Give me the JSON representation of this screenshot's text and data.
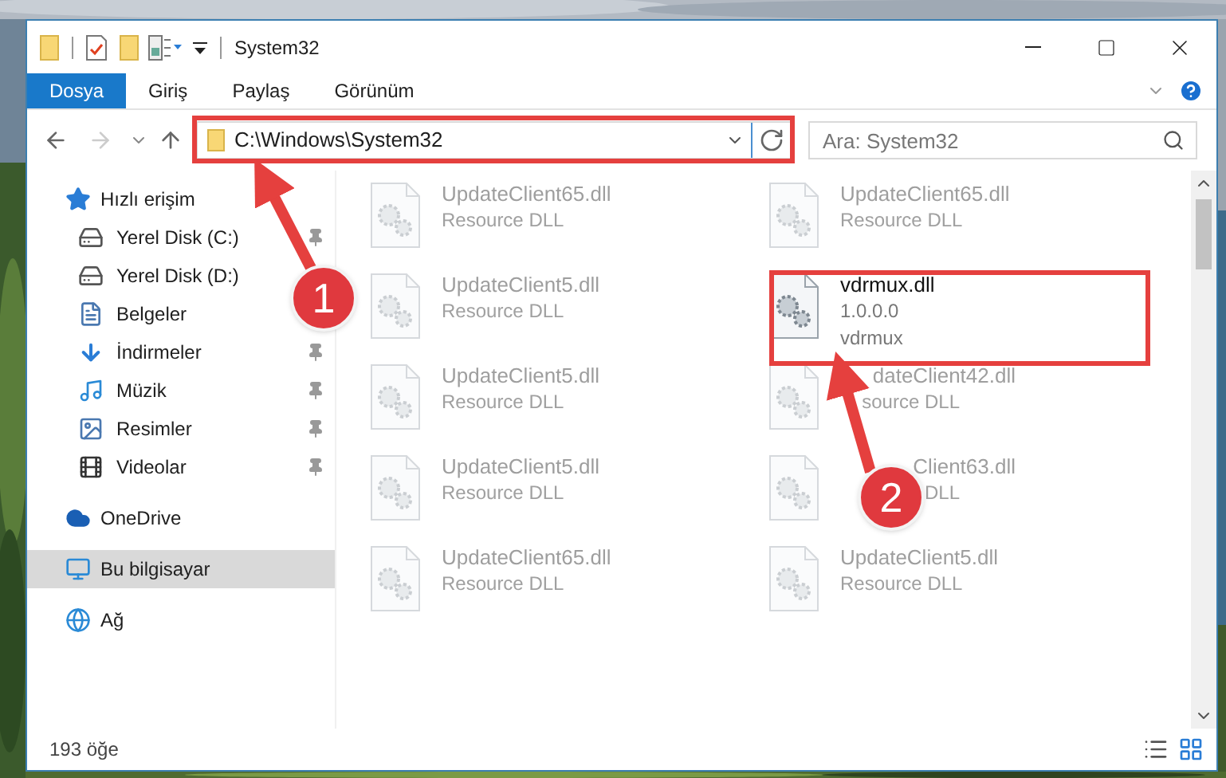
{
  "window": {
    "title": "System32"
  },
  "ribbon_tabs": [
    {
      "label": "Dosya",
      "kind": "file",
      "selected": true
    },
    {
      "label": "Giriş",
      "kind": "tab",
      "selected": false
    },
    {
      "label": "Paylaş",
      "kind": "tab",
      "selected": false
    },
    {
      "label": "Görünüm",
      "kind": "tab",
      "selected": false
    }
  ],
  "address_bar": {
    "path": "C:\\Windows\\System32"
  },
  "search": {
    "placeholder": "Ara: System32"
  },
  "navigation": [
    {
      "label": "Hızlı erişim",
      "kind": "star",
      "selected": false,
      "children": [
        {
          "label": "Yerel Disk (C:)",
          "kind": "drive-c",
          "pinned": true
        },
        {
          "label": "Yerel Disk (D:)",
          "kind": "drive"
        },
        {
          "label": "Belgeler",
          "kind": "documents"
        },
        {
          "label": "İndirmeler",
          "kind": "downloads",
          "pinned": true
        },
        {
          "label": "Müzik",
          "kind": "music",
          "pinned": true
        },
        {
          "label": "Resimler",
          "kind": "pictures",
          "pinned": true
        },
        {
          "label": "Videolar",
          "kind": "videos",
          "pinned": true
        }
      ]
    },
    {
      "label": "OneDrive",
      "kind": "cloud",
      "selected": false
    },
    {
      "label": "Bu bilgisayar",
      "kind": "computer",
      "selected": true
    },
    {
      "label": "Ağ",
      "kind": "network",
      "selected": false
    }
  ],
  "files": [
    {
      "name": "UpdateClient65.dll",
      "details": [
        "Resource DLL"
      ],
      "blurred": true
    },
    {
      "name": "UpdateClient65.dll",
      "details": [
        "Resource DLL"
      ],
      "blurred": true
    },
    {
      "name": "UpdateClient5.dll",
      "details": [
        "Resource DLL"
      ],
      "blurred": true
    },
    {
      "name": "vdrmux.dll",
      "details": [
        "1.0.0.0",
        "vdrmux"
      ],
      "blurred": false
    },
    {
      "name": "UpdateClient5.dll",
      "details": [
        "Resource DLL"
      ],
      "blurred": true
    },
    {
      "name": "dateClient42.dll",
      "details": [
        "source DLL"
      ],
      "blurred": true,
      "kind": "covered"
    },
    {
      "name": "UpdateClient5.dll",
      "details": [
        "Resource DLL"
      ],
      "blurred": true
    },
    {
      "name": "Client63.dll",
      "details": [
        "DLL"
      ],
      "blurred": true,
      "kind": "covered"
    },
    {
      "name": "UpdateClient65.dll",
      "details": [
        "Resource DLL"
      ],
      "blurred": true
    },
    {
      "name": "UpdateClient5.dll",
      "details": [
        "Resource DLL"
      ],
      "blurred": true
    }
  ],
  "status_bar": {
    "item_count": "193 öğe"
  },
  "annotations": [
    {
      "label": "1"
    },
    {
      "label": "2"
    }
  ]
}
